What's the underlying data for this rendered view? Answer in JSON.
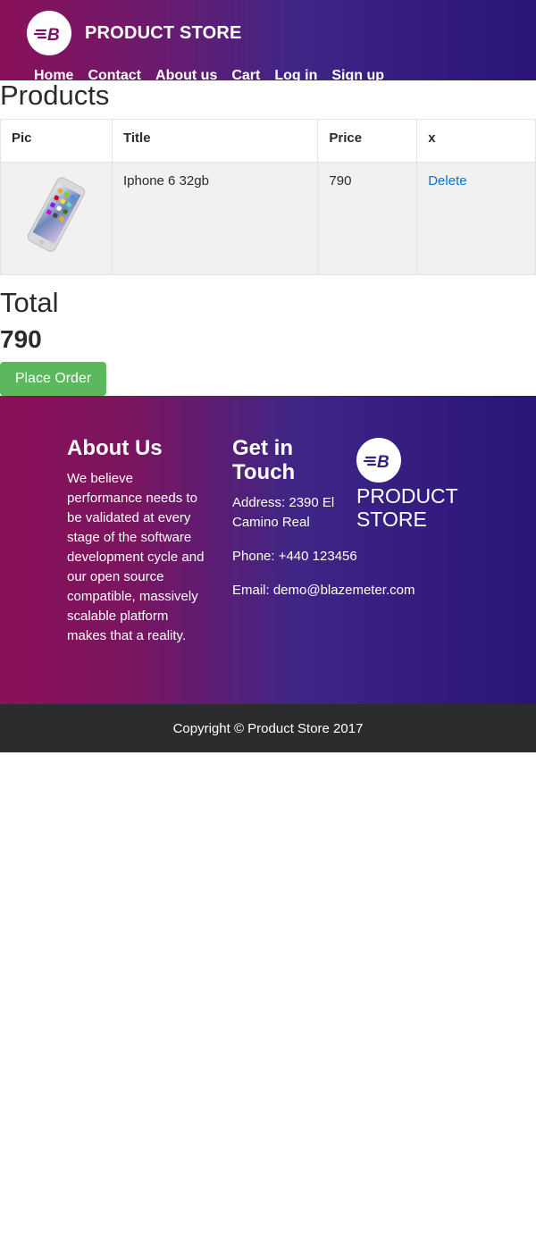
{
  "navbar": {
    "brand_name": "PRODUCT STORE",
    "logo_icon": "blazemeter-logo-icon",
    "links": [
      "Home",
      "Contact",
      "About us",
      "Cart",
      "Log in",
      "Sign up"
    ]
  },
  "products": {
    "title": "Products",
    "columns": [
      "Pic",
      "Title",
      "Price",
      "x"
    ],
    "rows": [
      {
        "pic_icon": "iphone-image",
        "title": "Iphone 6 32gb",
        "price": "790",
        "action": "Delete"
      }
    ]
  },
  "total": {
    "label": "Total",
    "value": "790",
    "place_order_label": "Place Order"
  },
  "footer": {
    "about_heading": "About Us",
    "about_text": "We believe performance needs to be validated at every stage of the software development cycle and our open source compatible, massively scalable platform makes that a reality.",
    "touch_heading": "Get in Touch",
    "address": "Address: 2390 El Camino Real",
    "phone": "Phone: +440 123456",
    "email": "Email: demo@blazemeter.com",
    "brand_name": "PRODUCT STORE",
    "copyright": "Copyright © Product Store 2017"
  },
  "colors": {
    "gradient_start": "#8a1058",
    "gradient_end": "#2a1478",
    "place_order_bg": "#5cb85c",
    "link_blue": "#0275d8",
    "footer_bottom_bg": "#2b2c2e"
  }
}
